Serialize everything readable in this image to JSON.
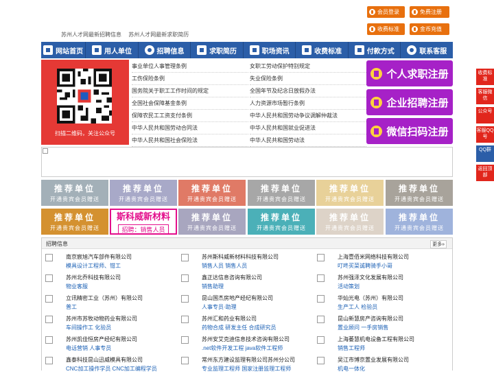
{
  "header": {
    "buttons": [
      {
        "label": "会员登录",
        "icon": "user-icon"
      },
      {
        "label": "免费注册",
        "icon": "register-icon"
      },
      {
        "label": "收费标准",
        "icon": "yen-icon"
      },
      {
        "label": "金币充值",
        "icon": "coin-icon"
      }
    ],
    "links": [
      "苏州人才网最新招聘信息",
      "苏州人才网最新求职简历"
    ]
  },
  "nav": [
    {
      "label": "网站首页",
      "icon": "home-icon"
    },
    {
      "label": "用人单位",
      "icon": "building-icon"
    },
    {
      "label": "招聘信息",
      "icon": "megaphone-icon"
    },
    {
      "label": "求职简历",
      "icon": "resume-icon"
    },
    {
      "label": "职场资讯",
      "icon": "news-icon"
    },
    {
      "label": "收费标准",
      "icon": "yen-icon"
    },
    {
      "label": "付款方式",
      "icon": "wallet-icon"
    },
    {
      "label": "联系客服",
      "icon": "phone-icon"
    }
  ],
  "qr": {
    "caption": "扫描二维码，关注公众号"
  },
  "laws": [
    "事业单位人事管理条例",
    "女职工劳动保护特别规定",
    "工伤保险条例",
    "失业保险条例",
    "国务院关于职工工作时间的规定",
    "全国年节及纪念日放假办法",
    "全国社会保障基金条例",
    "人力资源市场暂行条例",
    "保障农民工工资支付条例",
    "中华人民共和国劳动争议调解仲裁法",
    "中华人民共和国劳动合同法",
    "中华人民共和国就业促进法",
    "中华人民共和国社会保险法",
    "中华人民共和国劳动法"
  ],
  "register": [
    {
      "label": "个人求职注册",
      "icon": "person-icon"
    },
    {
      "label": "企业招聘注册",
      "icon": "company-icon"
    },
    {
      "label": "微信扫码注册",
      "icon": "wechat-icon"
    }
  ],
  "recommend": {
    "title": "推荐单位",
    "subtitle": "开通贵宾会员赠送",
    "colors": [
      "#a3b0b8",
      "#a8a9c8",
      "#e07a66",
      "#a7a7a7",
      "#e8d199",
      "#a8a39b",
      "#d49130",
      "#ffffff",
      "#a8a6bf",
      "#4bb0b8",
      "#ddd3c8",
      "#9fb3dc"
    ],
    "special": {
      "title": "斯科威新材料",
      "subtitle": "招聘：销售人员"
    }
  },
  "jobs": {
    "title": "招聘信息",
    "more": "更多»",
    "items": [
      {
        "company": "南京宸旭汽车部件有限公司",
        "positions": "模具设计工程师、钳工"
      },
      {
        "company": "苏州斯科威新材料科技有限公司",
        "positions": "销售人员 销售人员"
      },
      {
        "company": "上海壹佰米网络科技有限公司",
        "positions": "叮咚买菜诚聘骑手小哥"
      },
      {
        "company": "苏州北乔科技有限公司",
        "positions": "物业客服"
      },
      {
        "company": "鑫正达信息咨询有限公司",
        "positions": "销售助理"
      },
      {
        "company": "苏州强泽文化发展有限公司",
        "positions": "活动策划"
      },
      {
        "company": "立讯精密工业（苏州）有限公司",
        "positions": "普工"
      },
      {
        "company": "昆山国杰房地产经纪有限公司",
        "positions": "人事专员·助理"
      },
      {
        "company": "华灿光电（苏州）有限公司",
        "positions": "生产工人 检验员"
      },
      {
        "company": "苏州市苏牧动物药业有限公司",
        "positions": "车间操作工 化验员"
      },
      {
        "company": "苏州汇和药业有限公司",
        "positions": "药物合成 研发主任 合成研究员"
      },
      {
        "company": "昆山新慧房产咨询有限公司",
        "positions": "置业顾问 一手房销售"
      },
      {
        "company": "苏州凯佳恒房产经纪有限公司",
        "positions": "电话营销 人事专员"
      },
      {
        "company": "苏州安艾克迪信息技术咨询有限公司",
        "positions": ".net软件开发工程 java软件工程师"
      },
      {
        "company": "上海萎慧机电设备工程有限公司",
        "positions": "销售工程师"
      },
      {
        "company": "鑫泰科技昆山迅威模具有限公司",
        "positions": "CNC加工操作学员 CNC加工编程学员"
      },
      {
        "company": "常州东方建设监理有限公司苏州分公司",
        "positions": "专业监理工程师 国家注册监理工程师"
      },
      {
        "company": "吴江市博京置业发展有限公司",
        "positions": "机电一体化"
      }
    ]
  },
  "sidebar": [
    {
      "label": "收费标准"
    },
    {
      "label": "客服微信"
    },
    {
      "label": "公众号"
    },
    {
      "label": "客服QQ号"
    },
    {
      "label": "QQ群"
    },
    {
      "label": "返回顶部"
    }
  ],
  "colors": {
    "nav": "#2b5ea8",
    "accent": "#e8700e",
    "register": "#a621c7",
    "sidebar": "#e1261c"
  }
}
